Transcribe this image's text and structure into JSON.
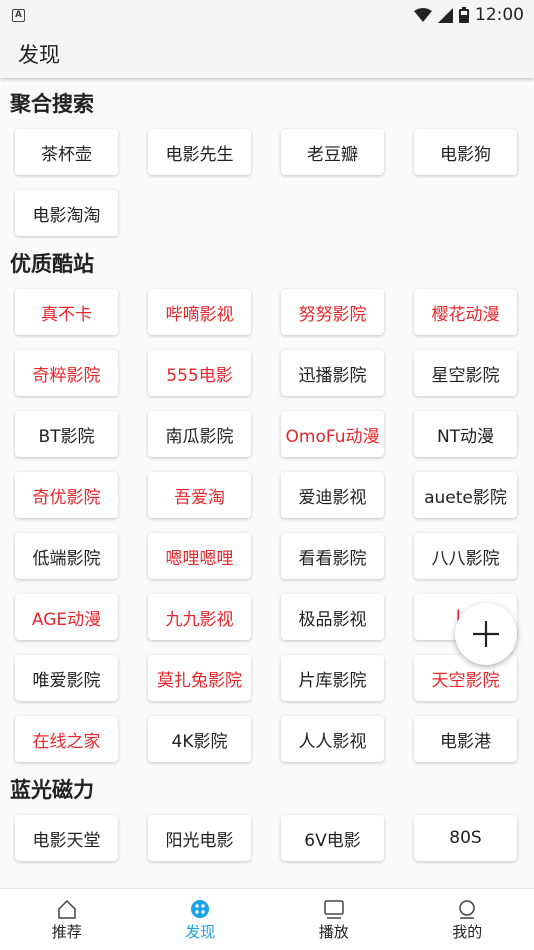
{
  "status": {
    "time": "12:00",
    "notif_letter": "A"
  },
  "appbar": {
    "title": "发现"
  },
  "sections": [
    {
      "title": "聚合搜索",
      "items": [
        {
          "label": "茶杯壶",
          "red": false
        },
        {
          "label": "电影先生",
          "red": false
        },
        {
          "label": "老豆瓣",
          "red": false
        },
        {
          "label": "电影狗",
          "red": false
        },
        {
          "label": "电影淘淘",
          "red": false
        }
      ]
    },
    {
      "title": "优质酷站",
      "items": [
        {
          "label": "真不卡",
          "red": true
        },
        {
          "label": "哔嘀影视",
          "red": true
        },
        {
          "label": "努努影院",
          "red": true
        },
        {
          "label": "樱花动漫",
          "red": true
        },
        {
          "label": "奇粹影院",
          "red": true
        },
        {
          "label": "555电影",
          "red": true
        },
        {
          "label": "迅播影院",
          "red": false
        },
        {
          "label": "星空影院",
          "red": false
        },
        {
          "label": "BT影院",
          "red": false
        },
        {
          "label": "南瓜影院",
          "red": false
        },
        {
          "label": "OmoFu动漫",
          "red": true
        },
        {
          "label": "NT动漫",
          "red": false
        },
        {
          "label": "奇优影院",
          "red": true
        },
        {
          "label": "吾爱淘",
          "red": true
        },
        {
          "label": "爱迪影视",
          "red": false
        },
        {
          "label": "auete影院",
          "red": false
        },
        {
          "label": "低端影院",
          "red": false
        },
        {
          "label": "嗯哩嗯哩",
          "red": true
        },
        {
          "label": "看看影院",
          "red": false
        },
        {
          "label": "八八影院",
          "red": false
        },
        {
          "label": "AGE动漫",
          "red": true
        },
        {
          "label": "九九影视",
          "red": true
        },
        {
          "label": "极品影视",
          "red": false
        },
        {
          "label": "LII",
          "red": true
        },
        {
          "label": "唯爱影院",
          "red": false
        },
        {
          "label": "莫扎兔影院",
          "red": true
        },
        {
          "label": "片库影院",
          "red": false
        },
        {
          "label": "天空影院",
          "red": true
        },
        {
          "label": "在线之家",
          "red": true
        },
        {
          "label": "4K影院",
          "red": false
        },
        {
          "label": "人人影视",
          "red": false
        },
        {
          "label": "电影港",
          "red": false
        }
      ]
    },
    {
      "title": "蓝光磁力",
      "items": [
        {
          "label": "电影天堂",
          "red": false
        },
        {
          "label": "阳光电影",
          "red": false
        },
        {
          "label": "6V电影",
          "red": false
        },
        {
          "label": "80S",
          "red": false
        }
      ]
    }
  ],
  "bottom_nav": [
    {
      "label": "推荐",
      "icon": "home-icon",
      "active": false
    },
    {
      "label": "发现",
      "icon": "discover-icon",
      "active": true
    },
    {
      "label": "播放",
      "icon": "play-icon",
      "active": false
    },
    {
      "label": "我的",
      "icon": "profile-icon",
      "active": false
    }
  ],
  "colors": {
    "accent": "#1aa3e8",
    "highlight_red": "#e8272d"
  }
}
